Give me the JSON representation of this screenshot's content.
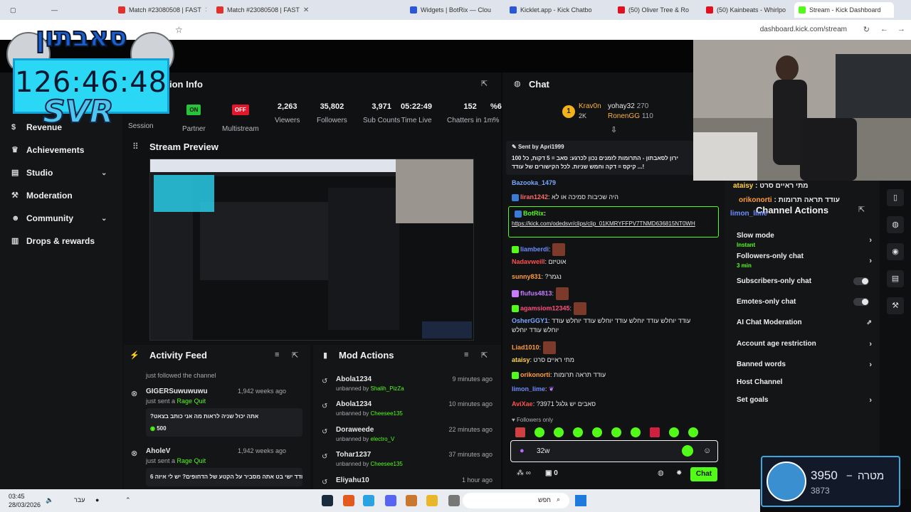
{
  "browser": {
    "tabs": [
      {
        "title": "Match #23080508 | FAST",
        "color": "#e0312c"
      },
      {
        "title": "Match #23080508 | FAST",
        "color": "#e0312c"
      },
      {
        "title": "Widgets | BotRix — Clou",
        "color": "#2b57d7"
      },
      {
        "title": "Kicklet.app - Kick Chatbo",
        "color": "#2b57d7"
      },
      {
        "title": "(50) Oliver Tree & Ro",
        "color": "#e01020"
      },
      {
        "title": "(50) Kainbeats - Whirlpo",
        "color": "#e01020"
      },
      {
        "title": "Stream - Kick Dashboard",
        "color": "#53fc18"
      }
    ],
    "url": "dashboard.kick.com/stream"
  },
  "overlay": {
    "timer": "126:46:48",
    "brand": "SVR",
    "header_art_text": "סאבתון",
    "goal": {
      "label": "מטרה",
      "target": "3950",
      "current": "3873"
    }
  },
  "sidebar": {
    "items": [
      {
        "label": "Revenue",
        "icon": "dollar-icon",
        "chevron": false
      },
      {
        "label": "Achievements",
        "icon": "trophy-icon",
        "chevron": false
      },
      {
        "label": "Studio",
        "icon": "studio-icon",
        "chevron": true
      },
      {
        "label": "Moderation",
        "icon": "wrench-icon",
        "chevron": false
      },
      {
        "label": "Community",
        "icon": "people-icon",
        "chevron": true
      },
      {
        "label": "Drops & rewards",
        "icon": "drops-icon",
        "chevron": false
      }
    ]
  },
  "session": {
    "title": "ion Info",
    "stats": [
      {
        "value": "ON",
        "label": "Partner",
        "kind": "on"
      },
      {
        "value": "OFF",
        "label": "Multistream",
        "kind": "off"
      },
      {
        "value": "2,263",
        "label": "Viewers"
      },
      {
        "value": "35,802",
        "label": "Followers"
      },
      {
        "value": "3,971",
        "label": "Sub Counts"
      },
      {
        "value": "05:22:49",
        "label": "Time Live"
      },
      {
        "value": "152",
        "label": "Chatters in 1m"
      },
      {
        "value": "%6",
        "label": "% "
      }
    ],
    "session_label": "Session"
  },
  "preview": {
    "title": "Stream Preview"
  },
  "activity": {
    "title": "Activity Feed",
    "items": [
      {
        "user": "",
        "action": "just followed the channel",
        "time": "",
        "gift": "",
        "msg": "",
        "amount": ""
      },
      {
        "user": "GIGERSuwuwuwu",
        "action": "just sent a",
        "gift": "Rage Quit",
        "time": "1,942 weeks ago",
        "msg": "?אתה יכול שניה לראות מה אני כותב בצאט",
        "amount": "500"
      },
      {
        "user": "AholeV",
        "action": "just sent a",
        "gift": "Rage Quit",
        "time": "1,942 weeks ago",
        "msg": "עודד ישי בט אתה מסביר על הקטע של הדחופים? יש לי איזה 6",
        "amount": ""
      }
    ]
  },
  "mod": {
    "title": "Mod Actions",
    "items": [
      {
        "user": "Abola1234",
        "action": "unbanned by",
        "by": "Shalih_PizZa",
        "time": "9 minutes ago"
      },
      {
        "user": "Abola1234",
        "action": "unbanned by",
        "by": "Cheesee135",
        "time": "10 minutes ago"
      },
      {
        "user": "Doraweede",
        "action": "unbanned by",
        "by": "electro_V",
        "time": "22 minutes ago"
      },
      {
        "user": "Tohar1237",
        "action": "unbanned by",
        "by": "Cheesee135",
        "time": "37 minutes ago"
      },
      {
        "user": "Eliyahu10",
        "action": "",
        "by": "",
        "time": "1 hour ago"
      }
    ]
  },
  "chat": {
    "title": "Chat",
    "leaderboard": {
      "first": {
        "name": "Krav0n",
        "amount": "2K"
      },
      "others": [
        {
          "name": "yohay32",
          "amount": "270"
        },
        {
          "name": "RonenGG",
          "amount": "110"
        }
      ]
    },
    "pinned": {
      "sent_by": "Sent by",
      "user": "Apri1999",
      "text1": "ירון לסאבתון - התרומות לזמנים נכון לכרגע: סאב = 5 דקות, כל 100",
      "text2": "קיקס = דקה וחמש שניות. לכל הקישורים של עודד ...!"
    },
    "messages": [
      {
        "user": "Bazooka_1479",
        "color": "#7aa7ff",
        "text": "",
        "emote": false
      },
      {
        "user": "liran1242",
        "color": "#ff6b6b",
        "text": "היה שכיבות סמיכה או לא",
        "emote": false
      },
      {
        "user": "BotRix",
        "color": "#53fc18",
        "text": "https://kick.com/odedsvr/clips/clip_01KMRYFFPV7TNMD636815NT0WH",
        "emote": false
      },
      {
        "user": "liamberdi",
        "color": "#6d8cff",
        "text": "",
        "emote": true
      },
      {
        "user": "Nadavweill",
        "color": "#ff5050",
        "text": "אוטיזם",
        "emote": false
      },
      {
        "user": "sunny831",
        "color": "#ff9d3a",
        "text": "?נגמר",
        "emote": false
      },
      {
        "user": "flufus4813",
        "color": "#c77dff",
        "text": "",
        "emote": true
      },
      {
        "user": "agamsiom12345",
        "color": "#ff4f7b",
        "text": "",
        "emote": true
      },
      {
        "user": "OsherGGY1",
        "color": "#7aa7ff",
        "text": "עודד יוחלש עודד יוחלש עודד יוחלש עודד יוחלש עודד",
        "text2": "יוחלש עודד יוחלש",
        "emote": false
      },
      {
        "user": "Liad1010",
        "color": "#ff9d3a",
        "text": "",
        "emote": true
      },
      {
        "user": "ataisy",
        "color": "#ffd24a",
        "text": "מתי ראיים סרט",
        "emote": false
      },
      {
        "user": "orikonorti",
        "color": "#ff9d3a",
        "text": "עודד תראה תרומות",
        "emote": false
      },
      {
        "user": "limon_lime",
        "color": "#6d8cff",
        "text": "",
        "emote": true
      },
      {
        "user": "AviXae",
        "color": "#ff5050",
        "text": "?סאבים יש גלגל 3971",
        "emote": false
      }
    ],
    "followers_only": "Followers only",
    "input_value": "32w",
    "count": "0",
    "send_label": "Chat"
  },
  "actions": {
    "title": "Channel Actions",
    "items": [
      {
        "label": "Slow mode",
        "sub": "Instant",
        "control": "chevron"
      },
      {
        "label": "Followers-only chat",
        "sub": "3 min",
        "control": "chevron"
      },
      {
        "label": "Subscribers-only chat",
        "sub": "",
        "control": "toggle"
      },
      {
        "label": "Emotes-only chat",
        "sub": "",
        "control": "toggle"
      },
      {
        "label": "AI Chat Moderation",
        "sub": "",
        "control": "external"
      },
      {
        "label": "Account age restriction",
        "sub": "",
        "control": "chevron"
      },
      {
        "label": "Banned words",
        "sub": "",
        "control": "chevron"
      },
      {
        "label": "Host Channel",
        "sub": "",
        "control": "none"
      },
      {
        "label": "Set goals",
        "sub": "",
        "control": "chevron"
      }
    ]
  },
  "webcam_chat": [
    {
      "user": "ataisy",
      "text": "מתי ראיים סרט"
    },
    {
      "user": "orikonorti",
      "text": "עודד תראה תרומות"
    },
    {
      "user": "limon_lime",
      "text": ""
    }
  ],
  "taskbar": {
    "time": "03:45",
    "date": "28/03/2026",
    "lang": "עבר",
    "search": "חפש"
  }
}
